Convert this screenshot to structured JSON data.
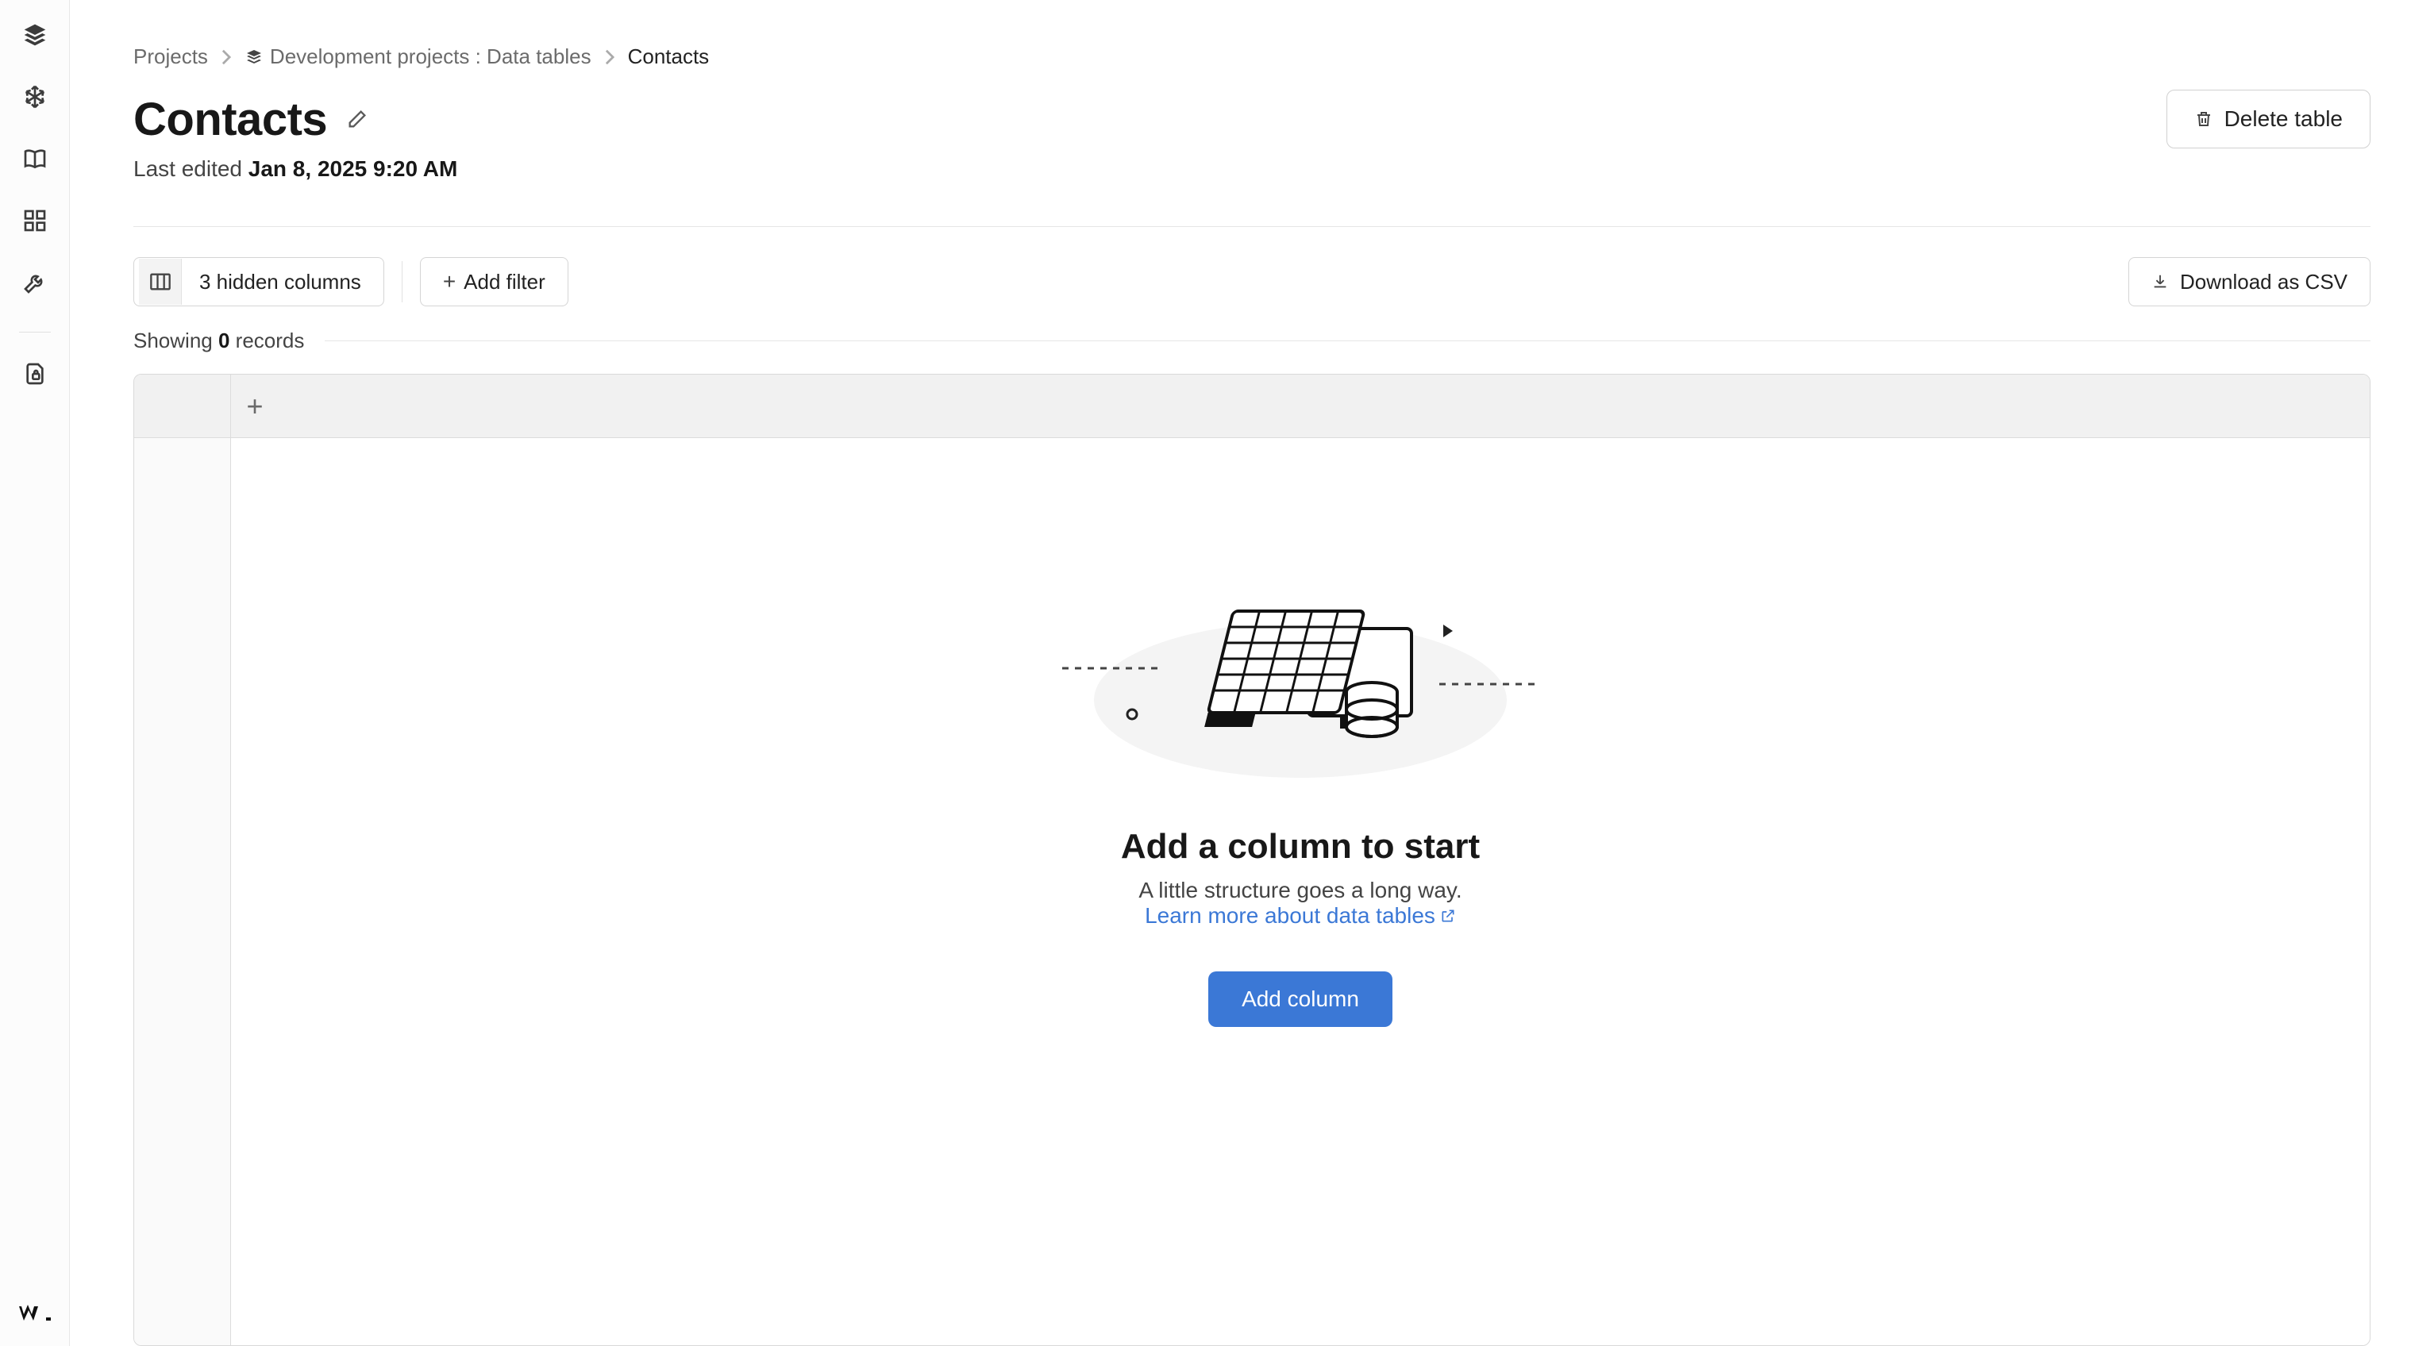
{
  "breadcrumb": {
    "projects": "Projects",
    "middle": "Development projects : Data tables",
    "current": "Contacts"
  },
  "title": "Contacts",
  "last_edited": {
    "label": "Last edited ",
    "timestamp": "Jan 8, 2025 9:20 AM"
  },
  "buttons": {
    "delete_table": "Delete table",
    "hidden_columns": "3 hidden columns",
    "add_filter": "Add filter",
    "download_csv": "Download as CSV",
    "add_column_primary": "Add column"
  },
  "record_count": {
    "prefix": "Showing ",
    "count": "0",
    "suffix": " records"
  },
  "empty_state": {
    "title": "Add a column to start",
    "subtitle_pre": "A little structure goes a long way. ",
    "link_text": "Learn more about data tables"
  }
}
